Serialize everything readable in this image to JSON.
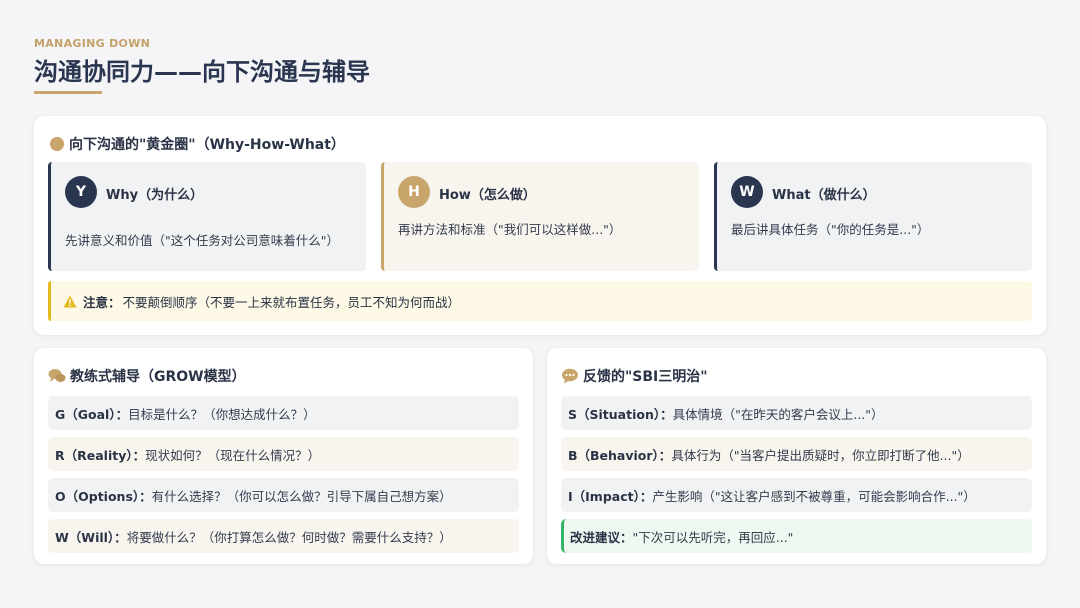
{
  "header": {
    "eyebrow": "MANAGING DOWN",
    "title": "沟通协同力——向下沟通与辅导"
  },
  "golden_circle": {
    "heading": "向下沟通的\"黄金圈\"（Why-How-What）",
    "items": [
      {
        "letter": "Y",
        "title": "Why（为什么）",
        "desc": "先讲意义和价值（\"这个任务对公司意味着什么\"）"
      },
      {
        "letter": "H",
        "title": "How（怎么做）",
        "desc": "再讲方法和标准（\"我们可以这样做...\"）"
      },
      {
        "letter": "W",
        "title": "What（做什么）",
        "desc": "最后讲具体任务（\"你的任务是...\"）"
      }
    ],
    "notice_label": "注意：",
    "notice_text": "不要颠倒顺序（不要一上来就布置任务，员工不知为何而战）"
  },
  "grow": {
    "heading": "教练式辅导（GROW模型）",
    "rows": [
      {
        "key": "G（Goal）：",
        "text": "目标是什么？（你想达成什么？）"
      },
      {
        "key": "R（Reality）：",
        "text": "现状如何？（现在什么情况？）"
      },
      {
        "key": "O（Options）：",
        "text": "有什么选择？（你可以怎么做？引导下属自己想方案）"
      },
      {
        "key": "W（Will）：",
        "text": "将要做什么？（你打算怎么做？何时做？需要什么支持？）"
      }
    ]
  },
  "sbi": {
    "heading": "反馈的\"SBI三明治\"",
    "rows": [
      {
        "key": "S（Situation）：",
        "text": "具体情境（\"在昨天的客户会议上...\"）"
      },
      {
        "key": "B（Behavior）：",
        "text": "具体行为（\"当客户提出质疑时，你立即打断了他...\"）"
      },
      {
        "key": "I（Impact）：",
        "text": "产生影响（\"这让客户感到不被尊重，可能会影响合作...\"）"
      }
    ],
    "suggestion_key": "改进建议：",
    "suggestion_text": "\"下次可以先听完，再回应...\""
  },
  "colors": {
    "gold": "#c8a56a",
    "navy": "#2a3550",
    "warning": "#e5b920",
    "success": "#34b36a"
  },
  "icons": [
    "gold-dot-icon",
    "chat-bubbles-icon",
    "warning-icon"
  ]
}
